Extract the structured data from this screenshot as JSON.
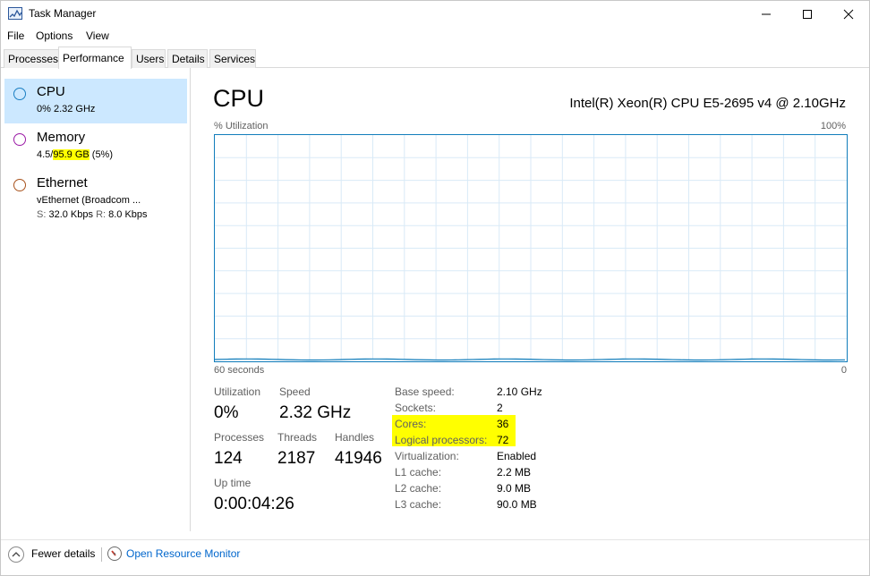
{
  "window": {
    "title": "Task Manager",
    "controls": {
      "minimize": "—",
      "maximize": "☐",
      "close": "✕"
    }
  },
  "menu": [
    "File",
    "Options",
    "View"
  ],
  "tabs": [
    "Processes",
    "Performance",
    "Users",
    "Details",
    "Services"
  ],
  "active_tab": "Performance",
  "sidebar": {
    "items": [
      {
        "title": "CPU",
        "line1": "0%  2.32 GHz",
        "color": "#1a7ec2"
      },
      {
        "title": "Memory",
        "pre": "4.5/",
        "highlight": "95.9 GB",
        "post": " (5%)",
        "color": "#9b1aa6"
      },
      {
        "title": "Ethernet",
        "line1": "vEthernet (Broadcom ...",
        "line2_label_s": "S:",
        "line2_val_s": " 32.0 Kbps ",
        "line2_label_r": "R:",
        "line2_val_r": " 8.0 Kbps",
        "color": "#a8531d"
      }
    ]
  },
  "main": {
    "title": "CPU",
    "model": "Intel(R) Xeon(R) CPU E5-2695 v4 @ 2.10GHz",
    "graph": {
      "top_left": "% Utilization",
      "top_right": "100%",
      "bottom_left": "60 seconds",
      "bottom_right": "0",
      "line_color": "#117dbb",
      "grid_color": "#d9eaf7"
    },
    "stats": {
      "utilization_label": "Utilization",
      "utilization_value": "0%",
      "speed_label": "Speed",
      "speed_value": "2.32 GHz",
      "processes_label": "Processes",
      "processes_value": "124",
      "threads_label": "Threads",
      "threads_value": "2187",
      "handles_label": "Handles",
      "handles_value": "41946",
      "uptime_label": "Up time",
      "uptime_value": "0:00:04:26"
    },
    "info": [
      {
        "label": "Base speed:",
        "value": "2.10 GHz",
        "highlight": false
      },
      {
        "label": "Sockets:",
        "value": "2",
        "highlight": false
      },
      {
        "label": "Cores:",
        "value": "36",
        "highlight": true
      },
      {
        "label": "Logical processors:",
        "value": "72",
        "highlight": true
      },
      {
        "label": "Virtualization:",
        "value": "Enabled",
        "highlight": false
      },
      {
        "label": "L1 cache:",
        "value": "2.2 MB",
        "highlight": false
      },
      {
        "label": "L2 cache:",
        "value": "9.0 MB",
        "highlight": false
      },
      {
        "label": "L3 cache:",
        "value": "90.0 MB",
        "highlight": false
      }
    ]
  },
  "footer": {
    "fewer_details": "Fewer details",
    "open_resource_monitor": "Open Resource Monitor"
  }
}
